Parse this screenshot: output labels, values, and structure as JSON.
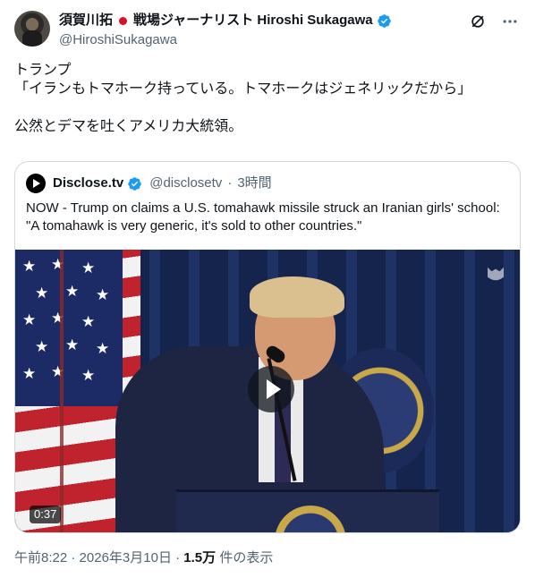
{
  "author": {
    "name": "須賀川拓",
    "name_suffix": "戦場ジャーナリスト Hiroshi Sukagawa",
    "handle": "@HiroshiSukagawa"
  },
  "tweet": {
    "text": "トランプ\n「イランもトマホーク持っている。トマホークはジェネリックだから」\n\n公然とデマを吐くアメリカ大統領。"
  },
  "quote": {
    "name": "Disclose.tv",
    "handle": "@disclosetv",
    "separator": "·",
    "time": "3時間",
    "text": "NOW - Trump on claims a U.S. tomahawk missile struck an Iranian girls' school: \"A tomahawk is very generic, it's sold to other countries.\"",
    "video_duration": "0:37"
  },
  "footer": {
    "time": "午前8:22",
    "sep1": "·",
    "date": "2026年3月10日",
    "sep2": "·",
    "views": "1.5万",
    "views_label": "件の表示"
  },
  "colors": {
    "verified": "#1d9bf0",
    "secondary_text": "#536471",
    "primary_text": "#0f1419",
    "border": "#cfd9de"
  },
  "icons": {
    "grok": "grok-icon",
    "more": "more-icon",
    "verified": "verified-badge-icon",
    "play": "play-icon"
  }
}
